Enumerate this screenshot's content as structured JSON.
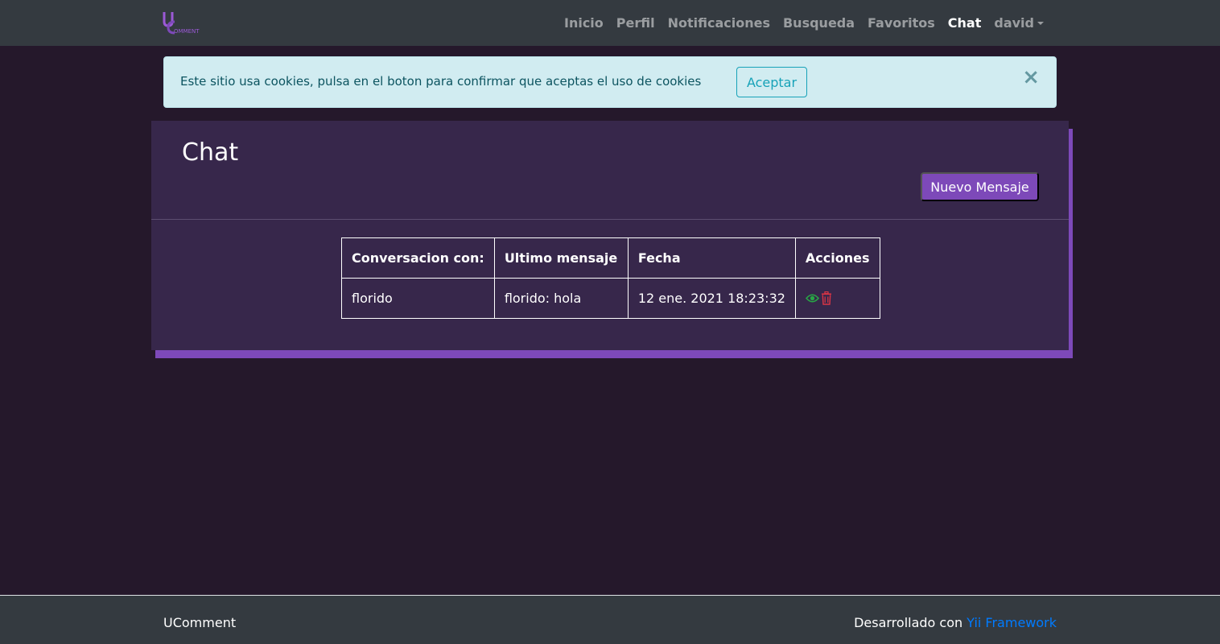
{
  "brand": {
    "logo_text": "OMMENT"
  },
  "nav": {
    "items": [
      {
        "label": "Inicio"
      },
      {
        "label": "Perfil"
      },
      {
        "label": "Notificaciones"
      },
      {
        "label": "Busqueda"
      },
      {
        "label": "Favoritos"
      },
      {
        "label": "Chat",
        "active": true
      }
    ],
    "user": "david"
  },
  "cookie_alert": {
    "message": "Este sitio usa cookies, pulsa en el boton para confirmar que aceptas el uso de cookies",
    "accept_label": "Aceptar",
    "close_symbol": "×"
  },
  "chat": {
    "title": "Chat",
    "new_message_label": "Nuevo Mensaje",
    "table": {
      "headers": [
        "Conversacion con:",
        "Ultimo mensaje",
        "Fecha",
        "Acciones"
      ],
      "rows": [
        {
          "user": "florido",
          "last_message": "florido: hola",
          "date": "12 ene. 2021 18:23:32",
          "actions": [
            "eye-icon",
            "trash-icon"
          ]
        }
      ]
    }
  },
  "footer": {
    "brand": "UComment",
    "developed_prefix": "Desarrollado con",
    "framework_link": "Yii Framework"
  },
  "colors": {
    "page_bg": "#25182b",
    "navbar_bg": "#343a40",
    "card_bg": "#37274b",
    "accent_purple": "#7d49b9",
    "alert_bg": "#d1ecf1",
    "view_green": "#28a745",
    "delete_red": "#dc3545",
    "link_blue": "#007bff"
  }
}
